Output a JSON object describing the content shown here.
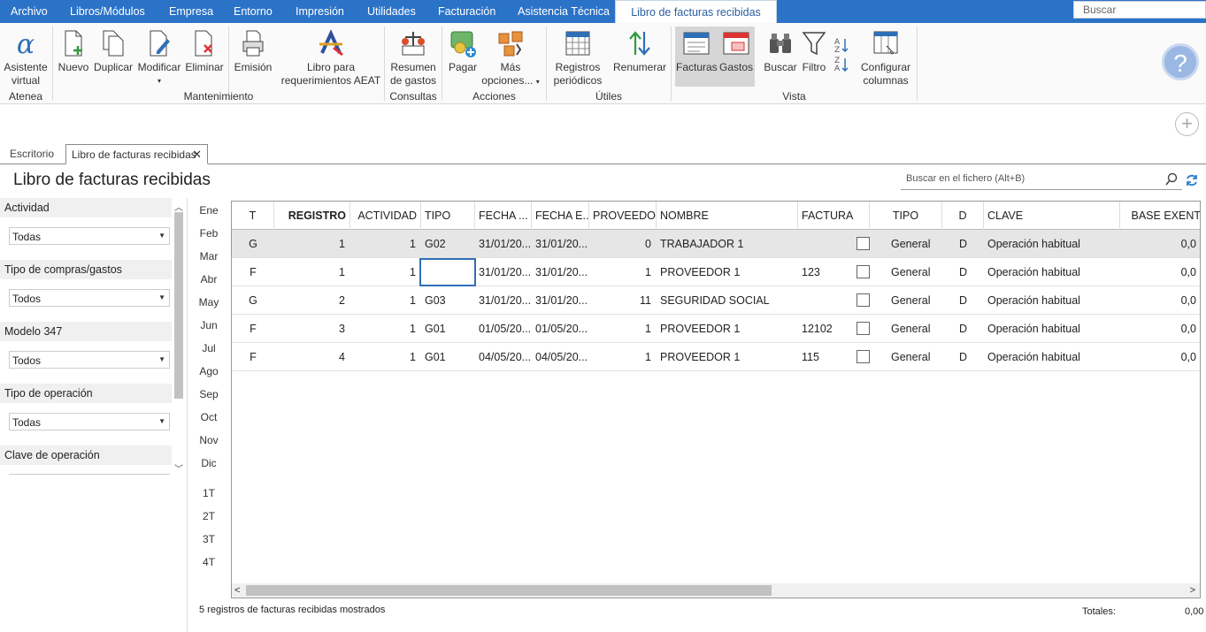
{
  "menu": {
    "items": [
      "Archivo",
      "Libros/Módulos",
      "Empresa",
      "Entorno",
      "Impresión",
      "Utilidades",
      "Facturación",
      "Asistencia Técnica",
      "Libro de facturas recibidas"
    ],
    "search_placeholder": "Buscar"
  },
  "ribbon": {
    "asistente": [
      "Asistente",
      "virtual"
    ],
    "nuevo": "Nuevo",
    "duplicar": "Duplicar",
    "modificar": "Modificar",
    "eliminar": "Eliminar",
    "emision": "Emisión",
    "libro_aeat": [
      "Libro para",
      "requerimientos AEAT"
    ],
    "resumen": [
      "Resumen",
      "de gastos"
    ],
    "pagar": "Pagar",
    "mas": [
      "Más",
      "opciones..."
    ],
    "registros": [
      "Registros",
      "periódicos"
    ],
    "renumerar": "Renumerar",
    "facturas": "Facturas",
    "gastos": "Gastos",
    "buscar": "Buscar",
    "filtro": "Filtro",
    "configurar": [
      "Configurar",
      "columnas"
    ],
    "groups": {
      "atenea": "Atenea",
      "mantenimiento": "Mantenimiento",
      "consultas": "Consultas",
      "acciones": "Acciones",
      "utiles": "Útiles",
      "vista": "Vista"
    }
  },
  "tabs": [
    "Escritorio",
    "Libro de facturas recibidas"
  ],
  "page": {
    "title": "Libro de facturas recibidas",
    "search_placeholder": "Buscar en el fichero (Alt+B)"
  },
  "filters": [
    {
      "label": "Actividad",
      "value": "Todas"
    },
    {
      "label": "Tipo de compras/gastos",
      "value": "Todos"
    },
    {
      "label": "Modelo 347",
      "value": "Todos"
    },
    {
      "label": "Tipo de operación",
      "value": "Todas"
    },
    {
      "label": "Clave de operación",
      "value": ""
    }
  ],
  "months": [
    "Ene",
    "Feb",
    "Mar",
    "Abr",
    "May",
    "Jun",
    "Jul",
    "Ago",
    "Sep",
    "Oct",
    "Nov",
    "Dic"
  ],
  "quarters": [
    "1T",
    "2T",
    "3T",
    "4T"
  ],
  "table": {
    "columns": [
      "T",
      "REGISTRO",
      "ACTIVIDAD",
      "TIPO",
      "FECHA ...",
      "FECHA E...",
      "PROVEEDOR",
      "NOMBRE",
      "FACTURA",
      "TIPO",
      "D",
      "CLAVE",
      "BASE EXENT"
    ],
    "rows": [
      [
        "G",
        "1",
        "1",
        "G02",
        "31/01/20...",
        "31/01/20...",
        "0",
        "TRABAJADOR 1",
        "",
        "General",
        "D",
        "Operación habitual",
        "0,0"
      ],
      [
        "F",
        "1",
        "1",
        "",
        "31/01/20...",
        "31/01/20...",
        "1",
        "PROVEEDOR 1",
        "123",
        "General",
        "D",
        "Operación habitual",
        "0,0"
      ],
      [
        "G",
        "2",
        "1",
        "G03",
        "31/01/20...",
        "31/01/20...",
        "11",
        "SEGURIDAD SOCIAL",
        "",
        "General",
        "D",
        "Operación habitual",
        "0,0"
      ],
      [
        "F",
        "3",
        "1",
        "G01",
        "01/05/20...",
        "01/05/20...",
        "1",
        "PROVEEDOR 1",
        "12102",
        "General",
        "D",
        "Operación habitual",
        "0,0"
      ],
      [
        "F",
        "4",
        "1",
        "G01",
        "04/05/20...",
        "04/05/20...",
        "1",
        "PROVEEDOR 1",
        "115",
        "General",
        "D",
        "Operación habitual",
        "0,0"
      ]
    ]
  },
  "status": {
    "text": "5 registros de facturas recibidas mostrados",
    "totals_label": "Totales:",
    "totals_value": "0,00"
  }
}
